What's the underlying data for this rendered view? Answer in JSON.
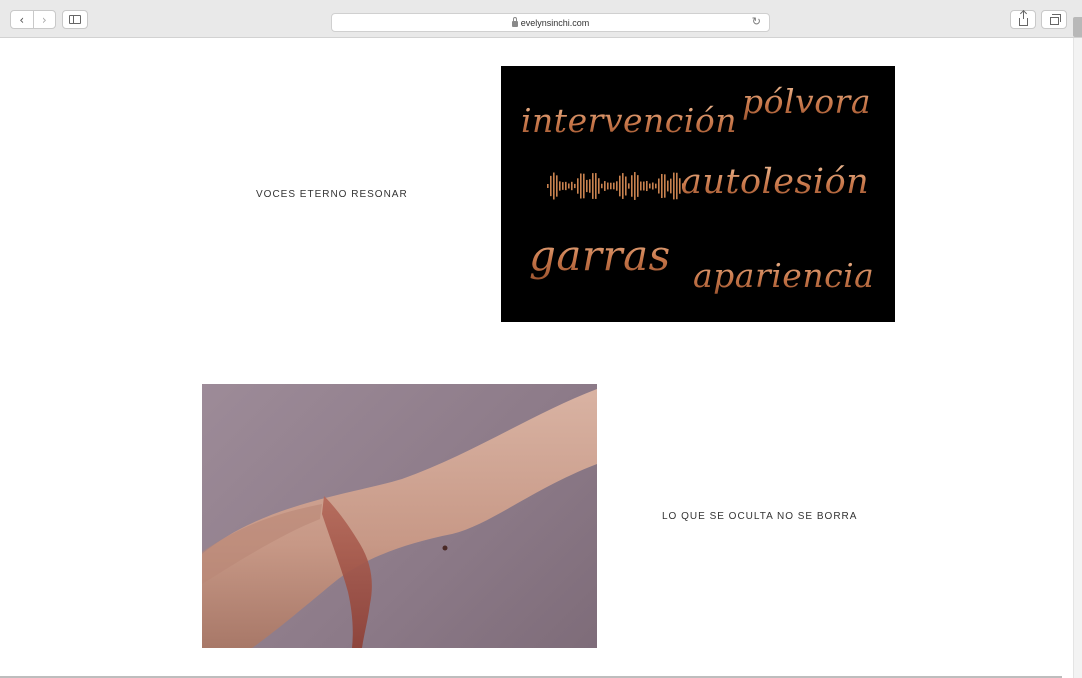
{
  "browser": {
    "url": "evelynsinchi.com",
    "back_glyph": "‹",
    "forward_glyph": "›",
    "reload_glyph": "↻"
  },
  "sections": [
    {
      "caption": "VOCES ETERNO RESONAR",
      "image": {
        "words": [
          "intervención",
          "pólvora",
          "autolesión",
          "garras",
          "apariencia"
        ],
        "icon": "sound-wave-icon",
        "background_color": "#000000",
        "text_color": "#d9996c"
      }
    },
    {
      "caption": "LO QUE SE OCULTA NO SE BORRA",
      "image": {
        "icon": "wrist-photo",
        "background_color": "#8f7d8b"
      }
    }
  ]
}
